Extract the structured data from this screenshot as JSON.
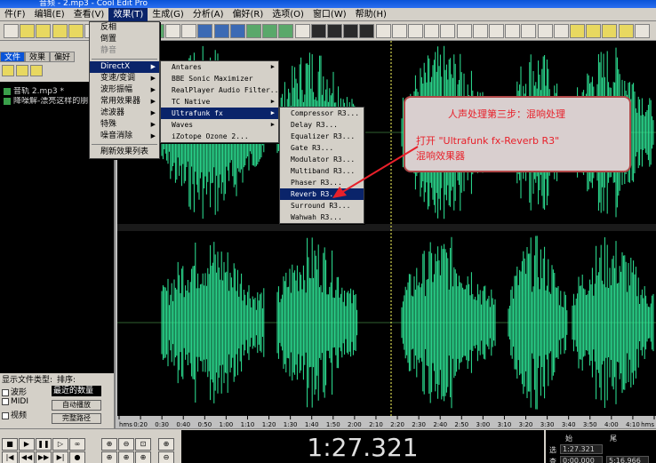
{
  "window": {
    "title": "音频 - 2.mp3 - Cool Edit Pro"
  },
  "menubar": {
    "items": [
      "件(F)",
      "编辑(E)",
      "查看(V)",
      "效果(T)",
      "生成(G)",
      "分析(A)",
      "偏好(R)",
      "选项(O)",
      "窗口(W)",
      "帮助(H)"
    ]
  },
  "left_panel": {
    "tabs": [
      "文件",
      "效果",
      "偏好"
    ],
    "files": [
      "音轨 2.mp3 *",
      "降噪解-漂亮这样的朋..."
    ],
    "type_label": "显示文件类型:",
    "sort_label": "排序:",
    "checkboxes": [
      "波形",
      "MIDI",
      "视频"
    ],
    "sort_value": "最近的数量",
    "btn1": "自动播放",
    "btn2": "完整路径"
  },
  "effects_menu": {
    "items": [
      "反相",
      "倒置",
      "静音",
      "DirectX",
      "变速/变调",
      "波形振幅",
      "常用效果器",
      "滤波器",
      "特殊",
      "噪音消除",
      "刷新效果列表"
    ],
    "highlighted": "DirectX"
  },
  "directx_menu": {
    "items": [
      "Antares",
      "BBE Sonic Maximizer",
      "RealPlayer Audio Filter...",
      "TC Native",
      "Ultrafunk fx",
      "Waves",
      "iZotope Ozone 2..."
    ],
    "highlighted": "Ultrafunk fx"
  },
  "ultrafunk_menu": {
    "items": [
      "Compressor R3...",
      "Delay R3...",
      "Equalizer R3...",
      "Gate R3...",
      "Modulator R3...",
      "Multiband R3...",
      "Phaser R3...",
      "Reverb R3...",
      "Surround R3...",
      "Wahwah R3..."
    ],
    "highlighted": "Reverb R3..."
  },
  "annotation": {
    "line1": "人声处理第三步：混响处理",
    "line2": "打开 \"Ultrafunk fx-Reverb R3\"",
    "line3": "混响效果器",
    "color": "#e8202a"
  },
  "timeline": {
    "ticks": [
      "hms",
      "0:20",
      "0:30",
      "0:40",
      "0:50",
      "1:00",
      "1:10",
      "1:20",
      "1:30",
      "1:40",
      "1:50",
      "2:00",
      "2:10",
      "2:20",
      "2:30",
      "2:40",
      "2:50",
      "3:00",
      "3:10",
      "3:20",
      "3:30",
      "3:40",
      "3:50",
      "4:00",
      "4:10",
      "hms"
    ]
  },
  "transport": {
    "time": "1:27.321",
    "start_label": "始",
    "end_label": "尾",
    "sel_label": "选",
    "view_label": "查",
    "sel_start": "1:27.321",
    "view_start": "0:00.000",
    "view_end": "5:16.966"
  },
  "colors": {
    "waveform": "#2ee898",
    "menu_highlight": "#0a246a"
  }
}
